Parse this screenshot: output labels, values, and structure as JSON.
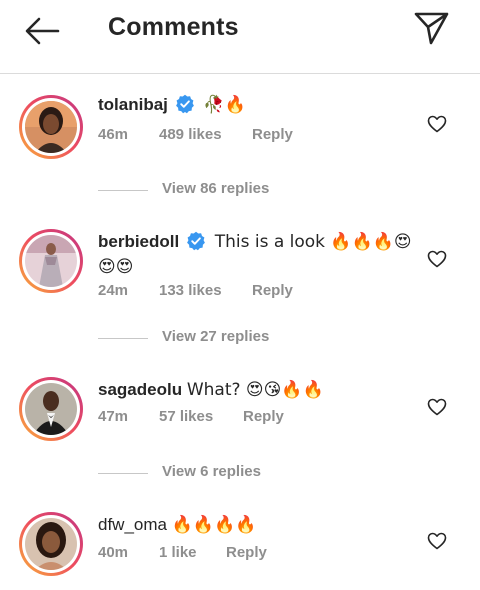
{
  "header": {
    "title": "Comments",
    "back_icon": "arrow-left-icon",
    "share_icon": "paper-plane-icon"
  },
  "colors": {
    "text": "#262626",
    "secondary": "#8e8e8e",
    "verified": "#3897f0",
    "divider": "#dbdbdb"
  },
  "comments": [
    {
      "username": "tolanibaj",
      "verified": true,
      "text": "🥀🔥",
      "time": "46m",
      "likes": "489 likes",
      "reply": "Reply",
      "view_replies": "View 86 replies"
    },
    {
      "username": "berbiedoll",
      "verified": true,
      "text": "This is a look 🔥🔥🔥😍",
      "text_line2": "😍😍",
      "time": "24m",
      "likes": "133 likes",
      "reply": "Reply",
      "view_replies": "View 27 replies"
    },
    {
      "username": "sagadeolu",
      "verified": false,
      "text": "What? 😍😘🔥🔥",
      "time": "47m",
      "likes": "57 likes",
      "reply": "Reply",
      "view_replies": "View 6 replies"
    },
    {
      "username": "dfw_oma",
      "verified": false,
      "text": "🔥🔥🔥🔥",
      "time": "40m",
      "likes": "1 like",
      "reply": "Reply"
    }
  ]
}
